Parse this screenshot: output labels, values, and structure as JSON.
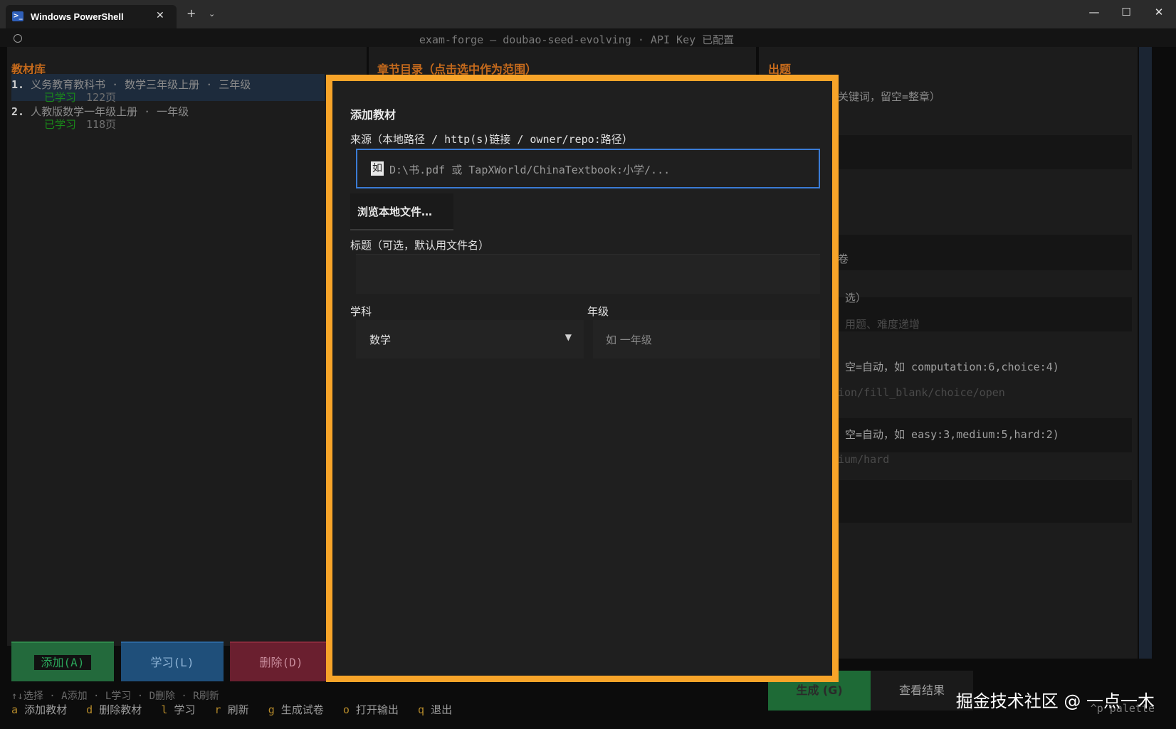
{
  "window": {
    "tab_title": "Windows PowerShell",
    "tab_icon": "powershell-icon",
    "close_glyph": "✕",
    "new_tab_glyph": "+",
    "dropdown_glyph": "⌄",
    "minimize_glyph": "—",
    "maximize_glyph": "☐",
    "win_close_glyph": "✕"
  },
  "header": {
    "text": "exam-forge — doubao-seed-evolving · API Key 已配置"
  },
  "library": {
    "title": "教材库",
    "items": [
      {
        "num": "1.",
        "text": " 义务教育教科书 · 数学三年级上册 · 三年级",
        "badge": "已学习",
        "pages": "122页"
      },
      {
        "num": "2.",
        "text": " 人教版数学一年级上册 · 一年级",
        "badge": "已学习",
        "pages": "118页"
      }
    ],
    "buttons": {
      "add": "添加(A)",
      "learn": "学习(L)",
      "delete": "删除(D)"
    }
  },
  "chapters": {
    "title": "章节目录（点击选中作为范围）"
  },
  "generate": {
    "title": "出题",
    "fragments": {
      "keywords": "关键词，留空=整章）",
      "paper": "卷",
      "select": "选）",
      "hint_difficulty": "用题、难度递增",
      "types_label": "空=自动，如 computation:6,choice:4)",
      "types_value": "ion/fill_blank/choice/open",
      "difficulty_label": "空=自动，如 easy:3,medium:5,hard:2)",
      "difficulty_value": "ium/hard"
    },
    "gen_button": "生成 (G)",
    "view_button": "查看结果"
  },
  "hints": {
    "line1": "↑↓选择 · A添加 · L学习 · D删除 · R刷新",
    "keys": [
      {
        "k": "a",
        "label": "添加教材"
      },
      {
        "k": "d",
        "label": "删除教材"
      },
      {
        "k": "l",
        "label": "学习"
      },
      {
        "k": "r",
        "label": "刷新"
      },
      {
        "k": "g",
        "label": "生成试卷"
      },
      {
        "k": "o",
        "label": "打开输出"
      },
      {
        "k": "q",
        "label": "退出"
      }
    ],
    "palette": "^p palette"
  },
  "modal": {
    "title": "添加教材",
    "source_label": "来源（本地路径 / http(s)链接 / owner/repo:路径）",
    "source_cursor": "如",
    "source_placeholder": "D:\\书.pdf 或 TapXWorld/ChinaTextbook:小学/...",
    "browse_button": "浏览本地文件…",
    "title_label": "标题（可选，默认用文件名）",
    "title_value": "",
    "subject_label": "学科",
    "subject_value": "数学",
    "subject_arrow": "▼",
    "grade_label": "年级",
    "grade_placeholder": "如 一年级"
  },
  "watermark": "掘金技术社区 @ 一点一木",
  "colors": {
    "modal_border": "#f7a429",
    "accent_blue": "#3a7bd5",
    "panel_title": "#c56a1c",
    "learned_green": "#1a8a1a",
    "add_green": "#236a3c",
    "learn_blue": "#1f4f7a",
    "delete_red": "#6a1f2f"
  }
}
